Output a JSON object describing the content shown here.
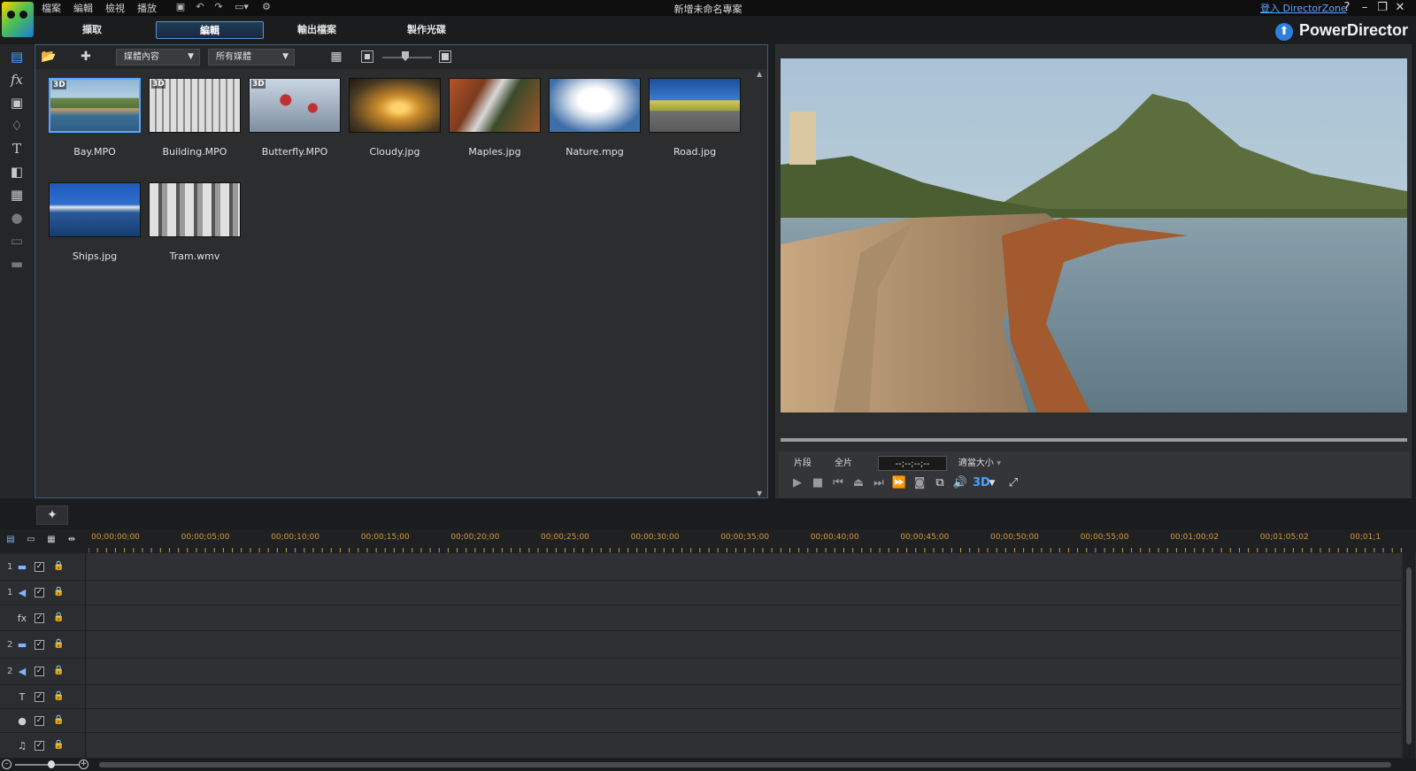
{
  "window": {
    "menus": [
      "檔案",
      "編輯",
      "檢視",
      "播放"
    ],
    "document_title": "新增未命名專案",
    "login_link": "登入 DirectorZone",
    "help": "?"
  },
  "modes": {
    "tabs": [
      "擷取",
      "編輯",
      "輸出檔案",
      "製作光碟"
    ],
    "active": "編輯",
    "brand": "PowerDirector"
  },
  "library": {
    "filter_dropdown": "媒體內容",
    "category_dropdown": "所有媒體",
    "items": [
      {
        "name": "Bay.MPO",
        "badge": "3D",
        "selected": true
      },
      {
        "name": "Building.MPO",
        "badge": "3D"
      },
      {
        "name": "Butterfly.MPO",
        "badge": "3D"
      },
      {
        "name": "Cloudy.jpg",
        "badge": ""
      },
      {
        "name": "Maples.jpg",
        "badge": ""
      },
      {
        "name": "Nature.mpg",
        "badge": ""
      },
      {
        "name": "Road.jpg",
        "badge": ""
      },
      {
        "name": "Ships.jpg",
        "badge": ""
      },
      {
        "name": "Tram.wmv",
        "badge": ""
      }
    ]
  },
  "preview": {
    "clip_btn": "片段",
    "movie_btn": "全片",
    "timecode": "--;--;--;--",
    "fit_dropdown": "適當大小",
    "stereo_label": "3D"
  },
  "timeline": {
    "ruler_labels": [
      "00;00;00;00",
      "00;00;05;00",
      "00;00;10;00",
      "00;00;15;00",
      "00;00;20;00",
      "00;00;25;00",
      "00;00;30;00",
      "00;00;35;00",
      "00;00;40;00",
      "00;00;45;00",
      "00;00;50;00",
      "00;00;55;00",
      "00;01;00;02",
      "00;01;05;02",
      "00;01;1"
    ],
    "tracks": [
      {
        "num": "1",
        "type": "video",
        "icon": "video-track-icon",
        "glyph": "▬"
      },
      {
        "num": "1",
        "type": "audio",
        "icon": "audio-track-icon",
        "glyph": "◀"
      },
      {
        "num": "",
        "type": "fx",
        "icon": "fx-track-icon",
        "glyph": "fx"
      },
      {
        "num": "2",
        "type": "video",
        "icon": "video-track-icon",
        "glyph": "▬"
      },
      {
        "num": "2",
        "type": "audio",
        "icon": "audio-track-icon",
        "glyph": "◀"
      },
      {
        "num": "",
        "type": "title",
        "icon": "title-track-icon",
        "glyph": "T"
      },
      {
        "num": "",
        "type": "voice",
        "icon": "microphone-track-icon",
        "glyph": "●"
      },
      {
        "num": "",
        "type": "music",
        "icon": "music-track-icon",
        "glyph": "♫"
      }
    ]
  },
  "colors": {
    "accent": "#4aa3ff",
    "timecode_text": "#d59a39"
  }
}
